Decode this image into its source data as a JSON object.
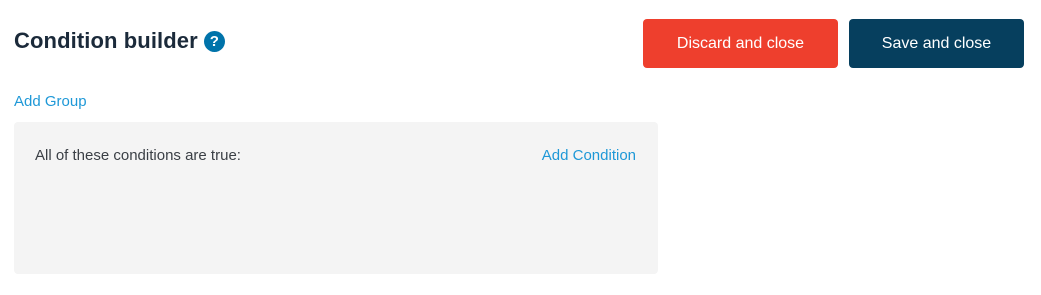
{
  "header": {
    "title": "Condition builder",
    "help_icon": "?",
    "help_icon_name": "question-circle-icon"
  },
  "actions": {
    "discard_label": "Discard and close",
    "save_label": "Save and close"
  },
  "builder": {
    "add_group_label": "Add Group",
    "groups": [
      {
        "label": "All of these conditions are true:",
        "add_condition_label": "Add Condition",
        "conditions": []
      }
    ]
  },
  "colors": {
    "discard": "#ee3f2d",
    "save": "#063f5e",
    "link": "#1e98d7",
    "help_icon": "#0073aa",
    "panel": "#f4f4f4"
  }
}
